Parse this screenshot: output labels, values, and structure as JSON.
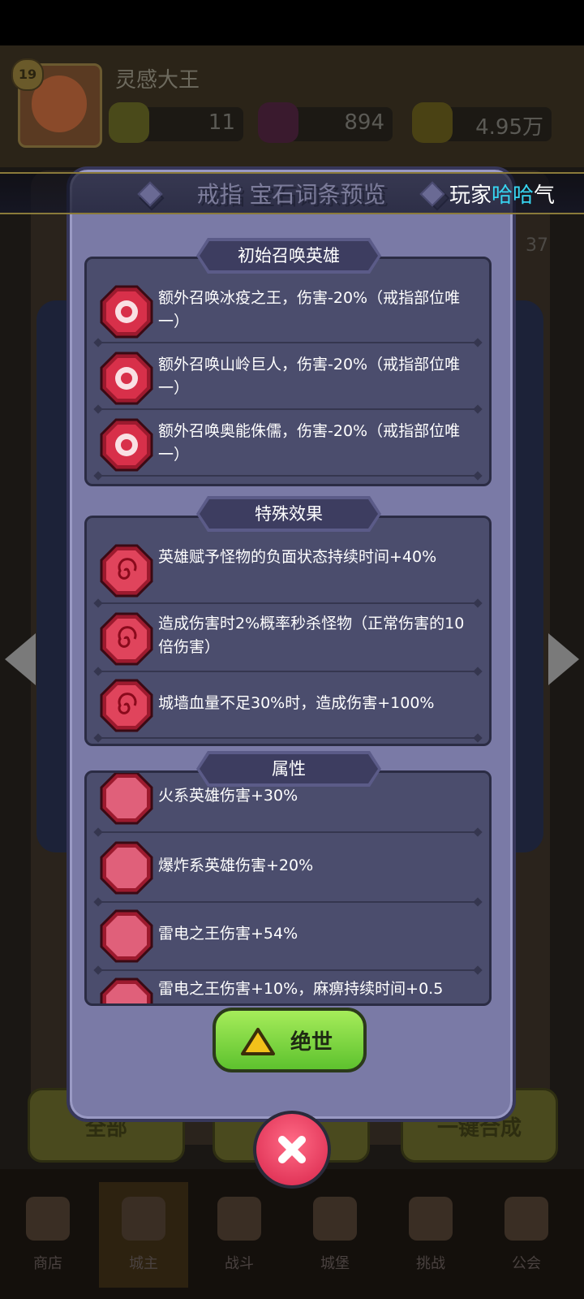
{
  "background": {
    "player_level": "19",
    "player_name": "灵感大王",
    "resources": [
      {
        "icon": "green-gem-icon",
        "value": "11"
      },
      {
        "icon": "purple-crystal-icon",
        "value": "894"
      },
      {
        "icon": "gold-coin-icon",
        "value": "4.95万"
      }
    ],
    "side_number": "37",
    "buttons": [
      "全部",
      "",
      "一键合成"
    ],
    "nav": [
      {
        "label": "商店"
      },
      {
        "label": "城主"
      },
      {
        "label": "战斗"
      },
      {
        "label": "城堡"
      },
      {
        "label": "挑战"
      },
      {
        "label": "公会"
      }
    ]
  },
  "banner": {
    "prefix": "玩家",
    "highlight": "哈哈",
    "suffix": "气"
  },
  "modal": {
    "title": "戒指 宝石词条预览",
    "sections": [
      {
        "header": "初始召唤英雄",
        "items": [
          {
            "text": "额外召唤冰疫之王，伤害-20%（戒指部位唯一）"
          },
          {
            "text": "额外召唤山岭巨人，伤害-20%（戒指部位唯一）"
          },
          {
            "text": "额外召唤奥能侏儒，伤害-20%（戒指部位唯一）"
          }
        ]
      },
      {
        "header": "特殊效果",
        "items": [
          {
            "text": "英雄赋予怪物的负面状态持续时间+40%"
          },
          {
            "text": "造成伤害时2%概率秒杀怪物（正常伤害的10倍伤害）"
          },
          {
            "text": "城墙血量不足30%时，造成伤害+100%"
          }
        ]
      },
      {
        "header": "属性",
        "items": [
          {
            "text": "火系英雄伤害+30%"
          },
          {
            "text": "爆炸系英雄伤害+20%"
          },
          {
            "text": "雷电之王伤害+54%"
          },
          {
            "text": "雷电之王伤害+10%，麻痹持续时间+0.5"
          }
        ]
      }
    ],
    "confirm_label": "绝世"
  },
  "colors": {
    "modal_bg": "#7a7aa6",
    "section_bg": "#4b4d6d",
    "confirm_green": "#7ed23e",
    "close_red": "#e8365a",
    "banner_highlight": "#37d6f2"
  }
}
